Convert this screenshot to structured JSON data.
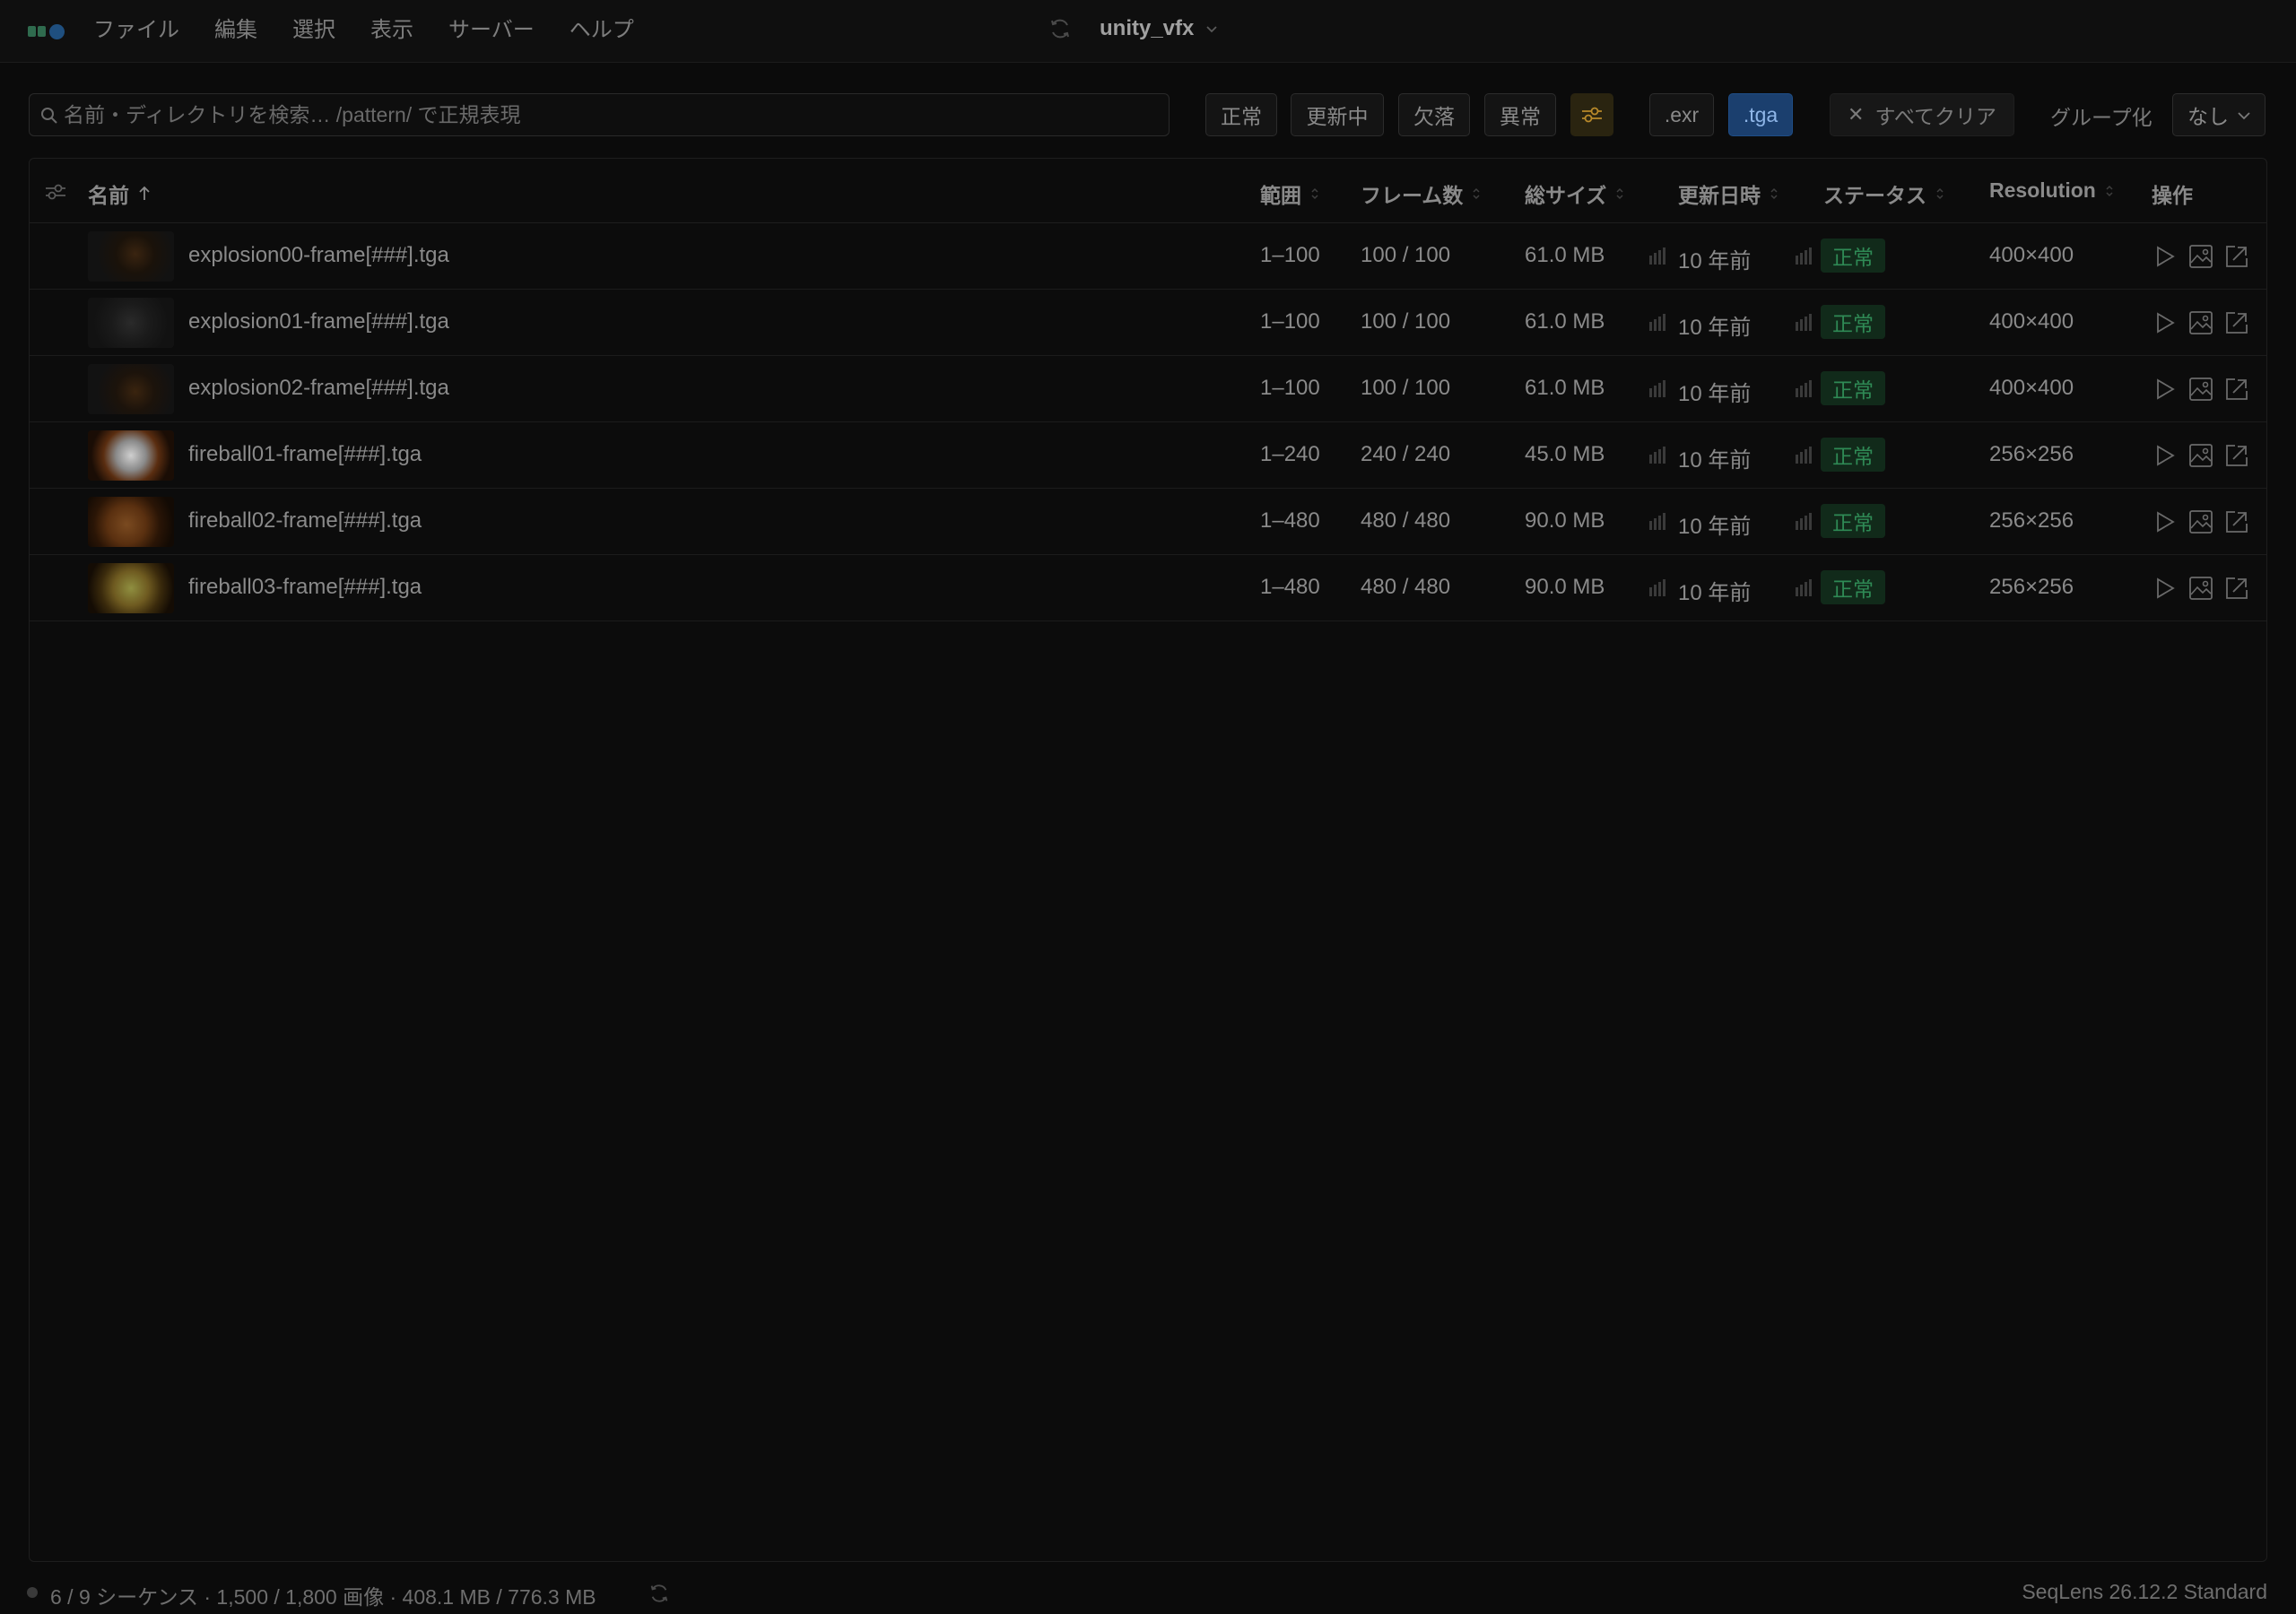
{
  "menubar": {
    "items": [
      "ファイル",
      "編集",
      "選択",
      "表示",
      "サーバー",
      "ヘルプ"
    ],
    "project_name": "unity_vfx"
  },
  "toolbar": {
    "search_placeholder": "名前・ディレクトリを検索… /pattern/ で正規表現",
    "status_filters": [
      "正常",
      "更新中",
      "欠落",
      "異常"
    ],
    "ext_filters": [
      ".exr",
      ".tga"
    ],
    "active_ext": ".tga",
    "clear_label": "すべてクリア",
    "groupby_label": "グループ化",
    "groupby_value": "なし"
  },
  "table": {
    "columns": {
      "name": "名前",
      "range": "範囲",
      "frames": "フレーム数",
      "size": "総サイズ",
      "modified": "更新日時",
      "status": "ステータス",
      "resolution": "Resolution",
      "actions": "操作"
    },
    "rows": [
      {
        "name": "explosion00-frame[###].tga",
        "range": "1–100",
        "frames": "100 / 100",
        "size": "61.0 MB",
        "modified": "10 年前",
        "status": "正常",
        "resolution": "400×400"
      },
      {
        "name": "explosion01-frame[###].tga",
        "range": "1–100",
        "frames": "100 / 100",
        "size": "61.0 MB",
        "modified": "10 年前",
        "status": "正常",
        "resolution": "400×400"
      },
      {
        "name": "explosion02-frame[###].tga",
        "range": "1–100",
        "frames": "100 / 100",
        "size": "61.0 MB",
        "modified": "10 年前",
        "status": "正常",
        "resolution": "400×400"
      },
      {
        "name": "fireball01-frame[###].tga",
        "range": "1–240",
        "frames": "240 / 240",
        "size": "45.0 MB",
        "modified": "10 年前",
        "status": "正常",
        "resolution": "256×256"
      },
      {
        "name": "fireball02-frame[###].tga",
        "range": "1–480",
        "frames": "480 / 480",
        "size": "90.0 MB",
        "modified": "10 年前",
        "status": "正常",
        "resolution": "256×256"
      },
      {
        "name": "fireball03-frame[###].tga",
        "range": "1–480",
        "frames": "480 / 480",
        "size": "90.0 MB",
        "modified": "10 年前",
        "status": "正常",
        "resolution": "256×256"
      }
    ]
  },
  "statusbar": {
    "summary": "6 / 9 シーケンス · 1,500 / 1,800 画像 · 408.1 MB / 776.3 MB",
    "version": "SeqLens 26.12.2 Standard"
  },
  "colors": {
    "background": "#0b0b0b",
    "accent": "#1b3f6e",
    "status_ok": "#2f8a55",
    "filter_icon": "#b8892a"
  }
}
